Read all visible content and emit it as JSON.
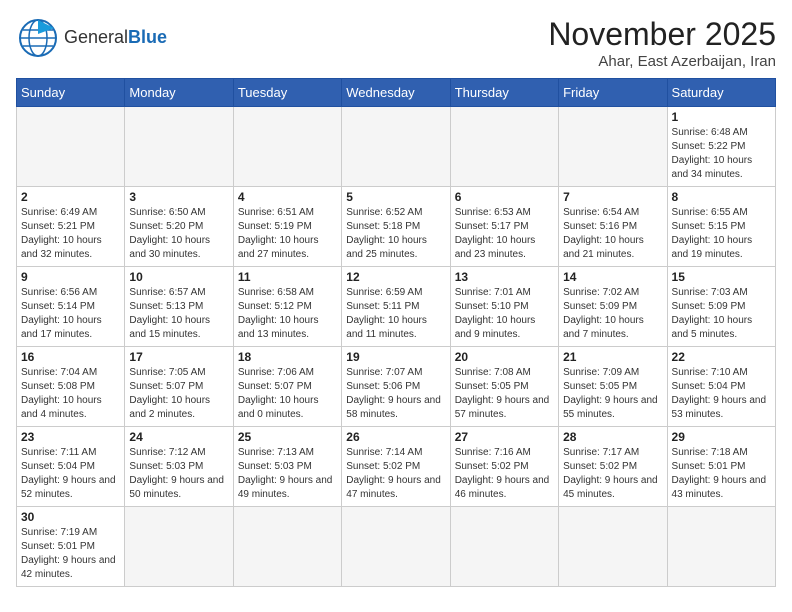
{
  "header": {
    "logo_general": "General",
    "logo_blue": "Blue",
    "month": "November 2025",
    "location": "Ahar, East Azerbaijan, Iran"
  },
  "days_of_week": [
    "Sunday",
    "Monday",
    "Tuesday",
    "Wednesday",
    "Thursday",
    "Friday",
    "Saturday"
  ],
  "weeks": [
    [
      {
        "day": "",
        "sunrise": "",
        "sunset": "",
        "daylight": ""
      },
      {
        "day": "",
        "sunrise": "",
        "sunset": "",
        "daylight": ""
      },
      {
        "day": "",
        "sunrise": "",
        "sunset": "",
        "daylight": ""
      },
      {
        "day": "",
        "sunrise": "",
        "sunset": "",
        "daylight": ""
      },
      {
        "day": "",
        "sunrise": "",
        "sunset": "",
        "daylight": ""
      },
      {
        "day": "",
        "sunrise": "",
        "sunset": "",
        "daylight": ""
      },
      {
        "day": "1",
        "sunrise": "6:48 AM",
        "sunset": "5:22 PM",
        "daylight": "10 hours and 34 minutes."
      }
    ],
    [
      {
        "day": "2",
        "sunrise": "6:49 AM",
        "sunset": "5:21 PM",
        "daylight": "10 hours and 32 minutes."
      },
      {
        "day": "3",
        "sunrise": "6:50 AM",
        "sunset": "5:20 PM",
        "daylight": "10 hours and 30 minutes."
      },
      {
        "day": "4",
        "sunrise": "6:51 AM",
        "sunset": "5:19 PM",
        "daylight": "10 hours and 27 minutes."
      },
      {
        "day": "5",
        "sunrise": "6:52 AM",
        "sunset": "5:18 PM",
        "daylight": "10 hours and 25 minutes."
      },
      {
        "day": "6",
        "sunrise": "6:53 AM",
        "sunset": "5:17 PM",
        "daylight": "10 hours and 23 minutes."
      },
      {
        "day": "7",
        "sunrise": "6:54 AM",
        "sunset": "5:16 PM",
        "daylight": "10 hours and 21 minutes."
      },
      {
        "day": "8",
        "sunrise": "6:55 AM",
        "sunset": "5:15 PM",
        "daylight": "10 hours and 19 minutes."
      }
    ],
    [
      {
        "day": "9",
        "sunrise": "6:56 AM",
        "sunset": "5:14 PM",
        "daylight": "10 hours and 17 minutes."
      },
      {
        "day": "10",
        "sunrise": "6:57 AM",
        "sunset": "5:13 PM",
        "daylight": "10 hours and 15 minutes."
      },
      {
        "day": "11",
        "sunrise": "6:58 AM",
        "sunset": "5:12 PM",
        "daylight": "10 hours and 13 minutes."
      },
      {
        "day": "12",
        "sunrise": "6:59 AM",
        "sunset": "5:11 PM",
        "daylight": "10 hours and 11 minutes."
      },
      {
        "day": "13",
        "sunrise": "7:01 AM",
        "sunset": "5:10 PM",
        "daylight": "10 hours and 9 minutes."
      },
      {
        "day": "14",
        "sunrise": "7:02 AM",
        "sunset": "5:09 PM",
        "daylight": "10 hours and 7 minutes."
      },
      {
        "day": "15",
        "sunrise": "7:03 AM",
        "sunset": "5:09 PM",
        "daylight": "10 hours and 5 minutes."
      }
    ],
    [
      {
        "day": "16",
        "sunrise": "7:04 AM",
        "sunset": "5:08 PM",
        "daylight": "10 hours and 4 minutes."
      },
      {
        "day": "17",
        "sunrise": "7:05 AM",
        "sunset": "5:07 PM",
        "daylight": "10 hours and 2 minutes."
      },
      {
        "day": "18",
        "sunrise": "7:06 AM",
        "sunset": "5:07 PM",
        "daylight": "10 hours and 0 minutes."
      },
      {
        "day": "19",
        "sunrise": "7:07 AM",
        "sunset": "5:06 PM",
        "daylight": "9 hours and 58 minutes."
      },
      {
        "day": "20",
        "sunrise": "7:08 AM",
        "sunset": "5:05 PM",
        "daylight": "9 hours and 57 minutes."
      },
      {
        "day": "21",
        "sunrise": "7:09 AM",
        "sunset": "5:05 PM",
        "daylight": "9 hours and 55 minutes."
      },
      {
        "day": "22",
        "sunrise": "7:10 AM",
        "sunset": "5:04 PM",
        "daylight": "9 hours and 53 minutes."
      }
    ],
    [
      {
        "day": "23",
        "sunrise": "7:11 AM",
        "sunset": "5:04 PM",
        "daylight": "9 hours and 52 minutes."
      },
      {
        "day": "24",
        "sunrise": "7:12 AM",
        "sunset": "5:03 PM",
        "daylight": "9 hours and 50 minutes."
      },
      {
        "day": "25",
        "sunrise": "7:13 AM",
        "sunset": "5:03 PM",
        "daylight": "9 hours and 49 minutes."
      },
      {
        "day": "26",
        "sunrise": "7:14 AM",
        "sunset": "5:02 PM",
        "daylight": "9 hours and 47 minutes."
      },
      {
        "day": "27",
        "sunrise": "7:16 AM",
        "sunset": "5:02 PM",
        "daylight": "9 hours and 46 minutes."
      },
      {
        "day": "28",
        "sunrise": "7:17 AM",
        "sunset": "5:02 PM",
        "daylight": "9 hours and 45 minutes."
      },
      {
        "day": "29",
        "sunrise": "7:18 AM",
        "sunset": "5:01 PM",
        "daylight": "9 hours and 43 minutes."
      }
    ],
    [
      {
        "day": "30",
        "sunrise": "7:19 AM",
        "sunset": "5:01 PM",
        "daylight": "9 hours and 42 minutes."
      },
      {
        "day": "",
        "sunrise": "",
        "sunset": "",
        "daylight": ""
      },
      {
        "day": "",
        "sunrise": "",
        "sunset": "",
        "daylight": ""
      },
      {
        "day": "",
        "sunrise": "",
        "sunset": "",
        "daylight": ""
      },
      {
        "day": "",
        "sunrise": "",
        "sunset": "",
        "daylight": ""
      },
      {
        "day": "",
        "sunrise": "",
        "sunset": "",
        "daylight": ""
      },
      {
        "day": "",
        "sunrise": "",
        "sunset": "",
        "daylight": ""
      }
    ]
  ],
  "labels": {
    "sunrise": "Sunrise:",
    "sunset": "Sunset:",
    "daylight": "Daylight:"
  }
}
